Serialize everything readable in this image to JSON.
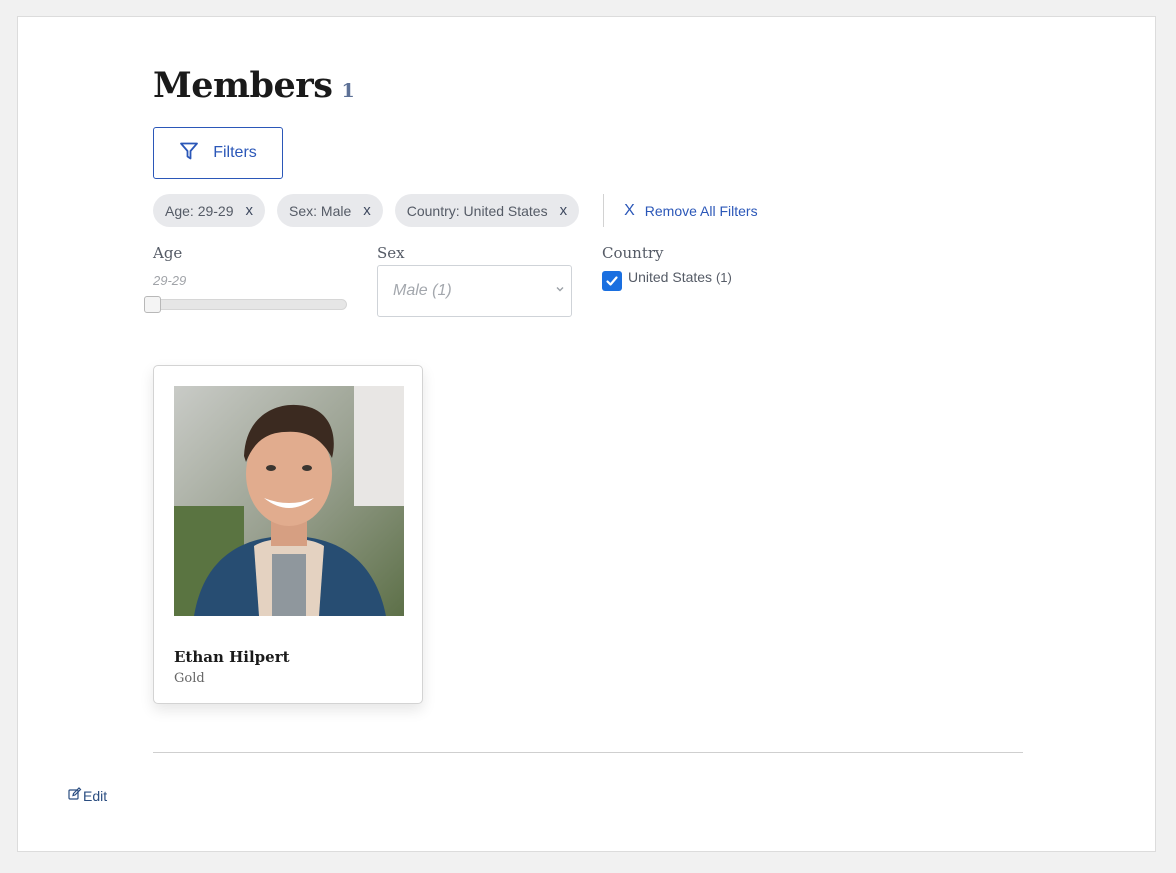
{
  "header": {
    "title": "Members",
    "count": "1"
  },
  "filters_button": {
    "label": "Filters",
    "icon": "filter-icon"
  },
  "active_filters": [
    {
      "label": "Age: 29-29",
      "remove": "x"
    },
    {
      "label": "Sex: Male",
      "remove": "x"
    },
    {
      "label": "Country: United States",
      "remove": "x"
    }
  ],
  "remove_all": {
    "icon": "X",
    "label": "Remove All Filters"
  },
  "facets": {
    "age": {
      "label": "Age",
      "value": "29-29",
      "level": 0
    },
    "sex": {
      "label": "Sex",
      "selected": "Male (1)"
    },
    "country": {
      "label": "Country",
      "option": "United States",
      "count": "(1)",
      "checked": true
    }
  },
  "members": [
    {
      "name": "Ethan Hilpert",
      "level": "Gold"
    }
  ],
  "footer": {
    "edit_label": "Edit",
    "edit_icon": "edit-icon"
  },
  "colors": {
    "accent": "#2b57b8",
    "checkbox": "#1a6fe0",
    "chip_bg": "#e8e9ec"
  }
}
